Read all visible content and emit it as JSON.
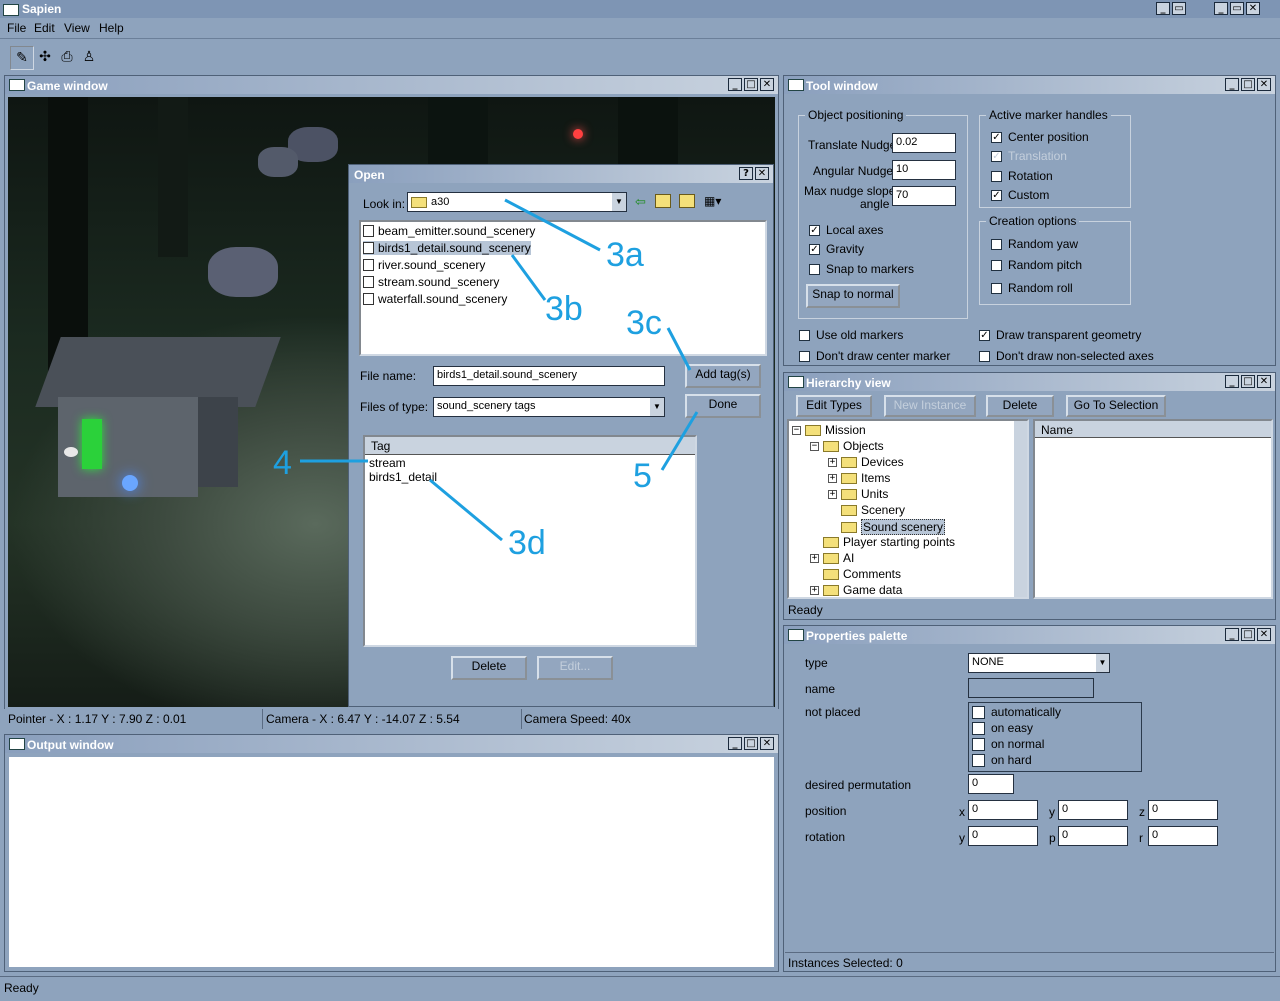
{
  "app": {
    "title": "Sapien"
  },
  "menu": [
    "File",
    "Edit",
    "View",
    "Help"
  ],
  "game_window": {
    "title": "Game window",
    "status": {
      "pointer": "Pointer - X : 1.17  Y : 7.90  Z : 0.01",
      "camera": "Camera - X : 6.47  Y : -14.07  Z : 5.54",
      "speed": "Camera Speed: 40x"
    }
  },
  "open_dialog": {
    "title": "Open",
    "look_in_label": "Look in:",
    "look_in_value": "a30",
    "files": [
      "beam_emitter.sound_scenery",
      "birds1_detail.sound_scenery",
      "river.sound_scenery",
      "stream.sound_scenery",
      "waterfall.sound_scenery"
    ],
    "file_name_label": "File name:",
    "file_name_value": "birds1_detail.sound_scenery",
    "files_of_type_label": "Files of type:",
    "files_of_type_value": "sound_scenery tags",
    "add_tags": "Add tag(s)",
    "done": "Done",
    "tag_header": "Tag",
    "tags": [
      "stream",
      "birds1_detail"
    ],
    "delete": "Delete",
    "edit": "Edit..."
  },
  "annotations": {
    "a3a": "3a",
    "a3b": "3b",
    "a3c": "3c",
    "a3d": "3d",
    "a4": "4",
    "a5": "5"
  },
  "output_window": {
    "title": "Output window"
  },
  "tool_window": {
    "title": "Tool window",
    "object_positioning": "Object positioning",
    "translate_nudge_label": "Translate Nudge",
    "translate_nudge": "0.02",
    "angular_nudge_label": "Angular Nudge",
    "angular_nudge": "10",
    "max_nudge_label_1": "Max nudge slope",
    "max_nudge_label_2": "angle",
    "max_nudge": "70",
    "local_axes": "Local axes",
    "gravity": "Gravity",
    "snap_to_markers": "Snap to markers",
    "snap_to_normal": "Snap to normal",
    "active_marker_handles": "Active marker handles",
    "center_position": "Center position",
    "translation": "Translation",
    "rotation": "Rotation",
    "custom": "Custom",
    "creation_options": "Creation options",
    "random_yaw": "Random yaw",
    "random_pitch": "Random pitch",
    "random_roll": "Random roll",
    "use_old_markers": "Use old markers",
    "dont_draw_center": "Don't draw center marker",
    "draw_transparent": "Draw transparent geometry",
    "dont_draw_nonselected": "Don't draw non-selected axes"
  },
  "hierarchy": {
    "title": "Hierarchy view",
    "edit_types": "Edit Types",
    "new_instance": "New Instance",
    "delete": "Delete",
    "go_to_selection": "Go To Selection",
    "tree": {
      "mission": "Mission",
      "objects": "Objects",
      "devices": "Devices",
      "items": "Items",
      "units": "Units",
      "scenery": "Scenery",
      "sound_scenery": "Sound scenery",
      "player_starting_points": "Player starting points",
      "ai": "AI",
      "comments": "Comments",
      "game_data": "Game data"
    },
    "name_header": "Name",
    "status": "Ready"
  },
  "properties": {
    "title": "Properties palette",
    "type_label": "type",
    "type_value": "NONE",
    "name_label": "name",
    "not_placed_label": "not placed",
    "not_placed": [
      "automatically",
      "on easy",
      "on normal",
      "on hard"
    ],
    "desired_permutation_label": "desired permutation",
    "desired_permutation": "0",
    "position_label": "position",
    "position": {
      "x_label": "x",
      "x": "0",
      "y_label": "y",
      "y": "0",
      "z_label": "z",
      "z": "0"
    },
    "rotation_label": "rotation",
    "rotation": {
      "y_label": "y",
      "y": "0",
      "p_label": "p",
      "p": "0",
      "r_label": "r",
      "r": "0"
    },
    "status": "Instances Selected: 0"
  },
  "status_bar": "Ready"
}
